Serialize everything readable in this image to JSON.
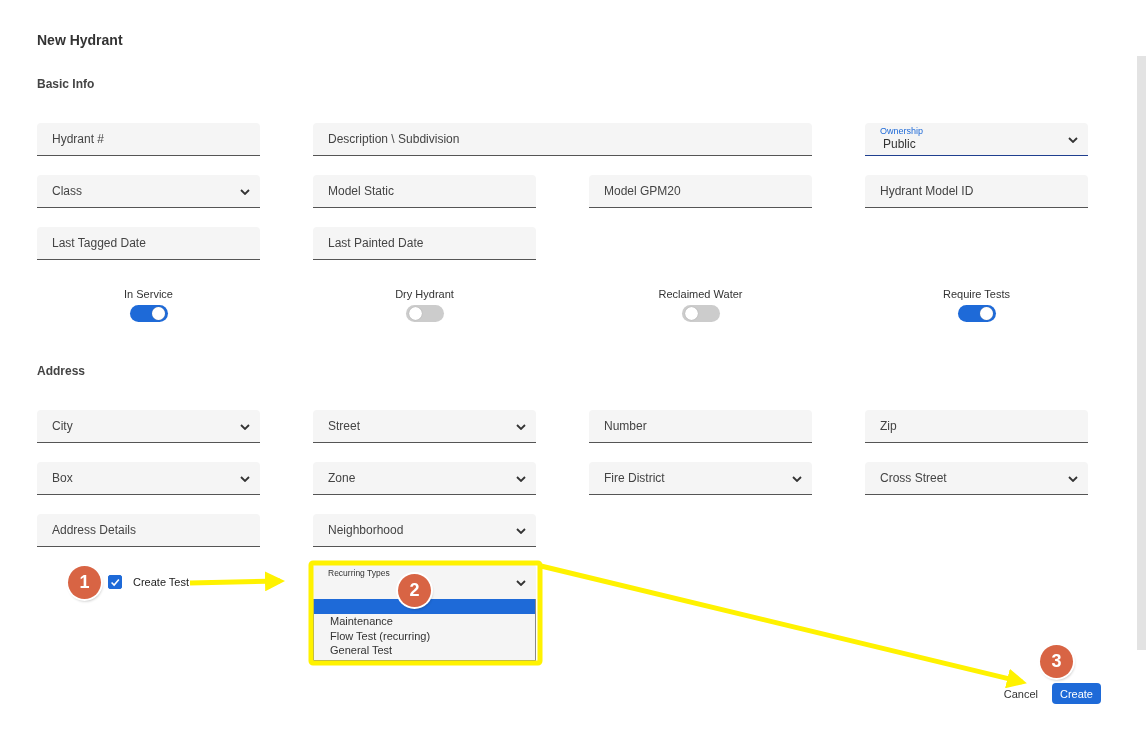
{
  "dialog": {
    "title": "New Hydrant"
  },
  "sections": [
    {
      "heading": "Basic Info",
      "fields": [
        {
          "kind": "text",
          "label": "Hydrant #"
        },
        {
          "kind": "wide_text",
          "label": "Description \\ Subdivision"
        },
        {
          "kind": "select",
          "label": "Ownership",
          "value": "Public",
          "focused": true
        },
        {
          "kind": "select",
          "label": "Class"
        },
        {
          "kind": "text",
          "label": "Model Static"
        },
        {
          "kind": "text",
          "label": "Model GPM20"
        },
        {
          "kind": "text",
          "label": "Hydrant Model ID"
        },
        {
          "kind": "text",
          "label": "Last Tagged Date"
        },
        {
          "kind": "text",
          "label": "Last Painted Date"
        }
      ],
      "toggles": [
        {
          "label": "In Service",
          "on": true
        },
        {
          "label": "Dry Hydrant",
          "on": false
        },
        {
          "label": "Reclaimed Water",
          "on": false
        },
        {
          "label": "Require Tests",
          "on": true
        }
      ]
    },
    {
      "heading": "Address",
      "fields": [
        {
          "kind": "select",
          "label": "City"
        },
        {
          "kind": "select",
          "label": "Street"
        },
        {
          "kind": "text",
          "label": "Number"
        },
        {
          "kind": "text",
          "label": "Zip"
        },
        {
          "kind": "select",
          "label": "Box"
        },
        {
          "kind": "select",
          "label": "Zone"
        },
        {
          "kind": "select",
          "label": "Fire District"
        },
        {
          "kind": "select",
          "label": "Cross Street"
        },
        {
          "kind": "text",
          "label": "Address Details"
        },
        {
          "kind": "select",
          "label": "Neighborhood"
        }
      ]
    }
  ],
  "create_test": {
    "label": "Create Test",
    "checked": true
  },
  "recurring_types": {
    "label": "Recurring Types",
    "expanded": true,
    "blank_option_highlighted": true,
    "options": [
      {
        "label": "Maintenance",
        "selected": false
      },
      {
        "label": "Flow Test (recurring)",
        "selected": false
      },
      {
        "label": "General Test",
        "selected": false
      }
    ]
  },
  "buttons": [
    {
      "kind": "link",
      "label": "Cancel"
    },
    {
      "kind": "primary",
      "label": "Create"
    }
  ],
  "annotations": {
    "markers": [
      {
        "label": "1"
      },
      {
        "label": "2"
      },
      {
        "label": "3"
      }
    ]
  }
}
